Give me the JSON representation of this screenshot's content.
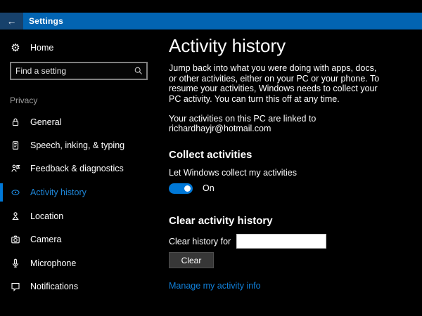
{
  "titlebar": {
    "back_glyph": "←",
    "title": "Settings"
  },
  "icons": {
    "gear": "⚙"
  },
  "sidebar": {
    "home_label": "Home",
    "search_placeholder": "Find a setting",
    "section_label": "Privacy",
    "items": [
      {
        "label": "General",
        "icon": "lock-icon",
        "selected": false
      },
      {
        "label": "Speech, inking, & typing",
        "icon": "speech-icon",
        "selected": false
      },
      {
        "label": "Feedback & diagnostics",
        "icon": "feedback-icon",
        "selected": false
      },
      {
        "label": "Activity history",
        "icon": "activity-history-icon",
        "selected": true
      },
      {
        "label": "Location",
        "icon": "location-icon",
        "selected": false
      },
      {
        "label": "Camera",
        "icon": "camera-icon",
        "selected": false
      },
      {
        "label": "Microphone",
        "icon": "microphone-icon",
        "selected": false
      },
      {
        "label": "Notifications",
        "icon": "notifications-icon",
        "selected": false
      }
    ]
  },
  "content": {
    "title": "Activity history",
    "description": "Jump back into what you were doing with apps, docs, or other activities, either on your PC or your phone. To resume your activities, Windows needs to collect your PC activity. You can turn this off at any time.",
    "linked_account": "Your activities on this PC are linked to richardhayjr@hotmail.com",
    "collect_heading": "Collect activities",
    "collect_toggle_label": "Let Windows collect my activities",
    "toggle_state": "On",
    "clear_heading": "Clear activity history",
    "clear_for_label": "Clear history for",
    "clear_button_label": "Clear",
    "manage_link": "Manage my activity info"
  },
  "colors": {
    "background": "#000000",
    "titlebar_blue": "#0264b2",
    "back_strip_blue": "#17416b",
    "accent": "#0078d7",
    "selected_text": "#1e86d8",
    "link": "#1180da",
    "section_label_gray": "#9d9d9d"
  }
}
